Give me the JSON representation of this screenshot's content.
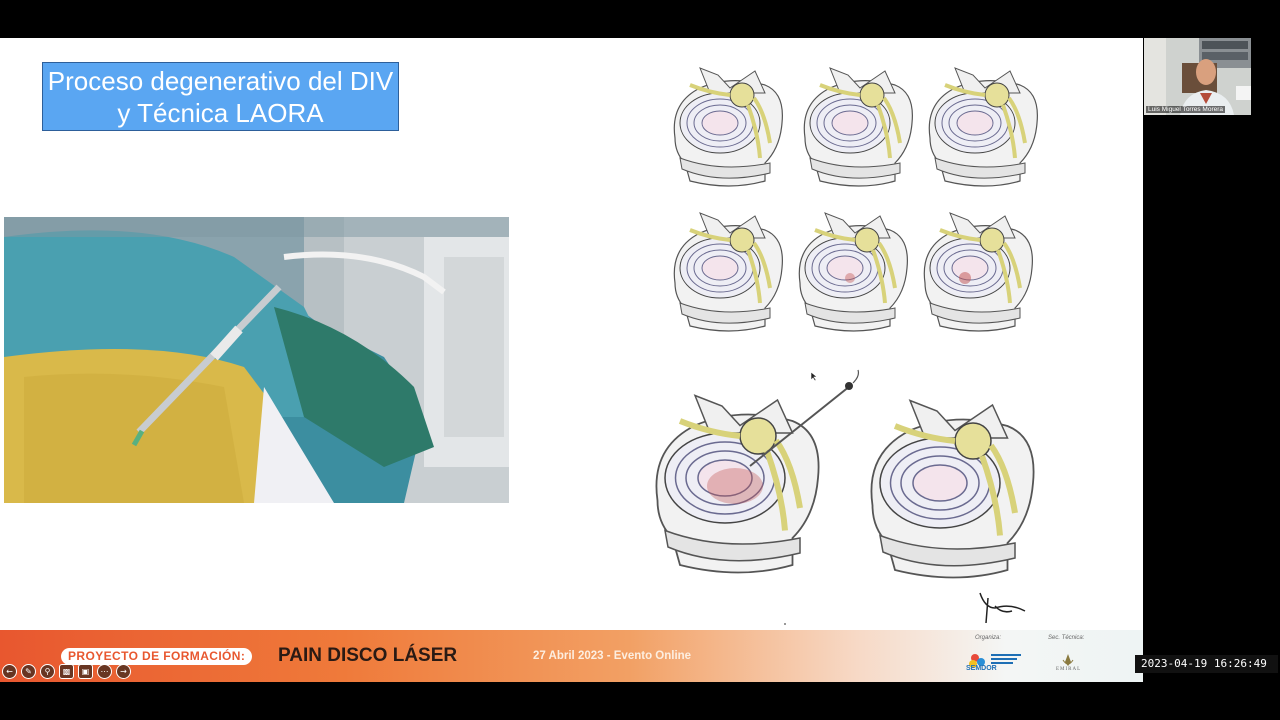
{
  "slide": {
    "title_line1": "Proceso degenerativo del DIV",
    "title_line2": "y Técnica LAORA"
  },
  "banner": {
    "project_label": "PROYECTO DE FORMACIÓN:",
    "title": "PAIN DISCO LÁSER",
    "event": "27 Abril 2023 - Evento Online",
    "organiza_label": "Organiza:",
    "sec_tecnica_label": "Sec. Técnica:",
    "org_name": "SEMDOR",
    "sec_name": "EMIRAL"
  },
  "participant": {
    "name": "Luis Miguel Torres Morera"
  },
  "timestamp": "2023-04-19  16:26:49",
  "toolbar": {
    "icons": [
      "arrow-left-icon",
      "pen-icon",
      "zoom-icon",
      "captions-icon",
      "screen-icon",
      "more-icon",
      "arrow-right-icon"
    ]
  },
  "colors": {
    "title_box": "#5aa6f2",
    "banner_orange": "#e8572f",
    "nerve_yellow": "#e6e09a"
  }
}
